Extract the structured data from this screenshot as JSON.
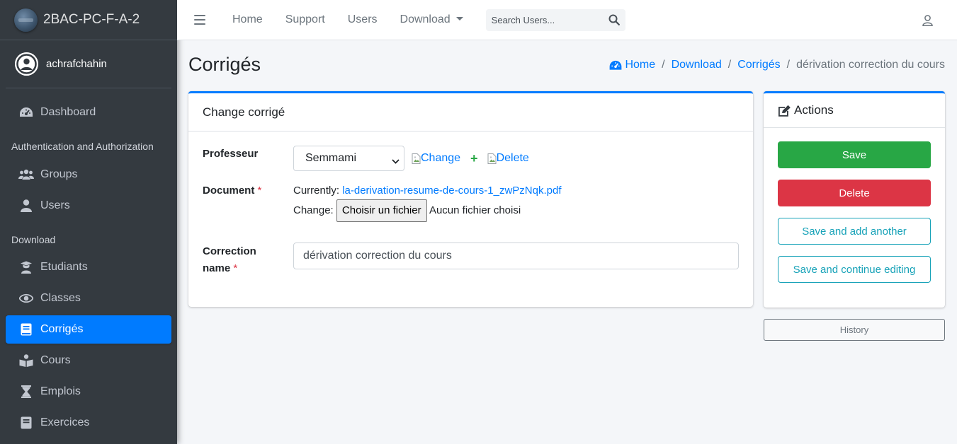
{
  "brand": {
    "name": "2BAC-PC-F-A-2"
  },
  "user": {
    "name": "achrafchahin"
  },
  "sidebar": {
    "dashboard": "Dashboard",
    "section_auth": "Authentication and Authorization",
    "groups": "Groups",
    "users": "Users",
    "section_download": "Download",
    "etudiants": "Etudiants",
    "classes": "Classes",
    "corriges": "Corrigés",
    "cours": "Cours",
    "emplois": "Emplois",
    "exercices": "Exercices",
    "active_color": "#007bff"
  },
  "topnav": {
    "home": "Home",
    "support": "Support",
    "users": "Users",
    "download": "Download",
    "search_placeholder": "Search Users..."
  },
  "page": {
    "title": "Corrigés"
  },
  "breadcrumb": {
    "home": "Home",
    "download": "Download",
    "corriges": "Corrigés",
    "current": "dérivation correction du cours"
  },
  "form": {
    "card_title": "Change corrigé",
    "professeur_label": "Professeur",
    "professeur_value": "Semmami",
    "change_link": "Change",
    "delete_link": "Delete",
    "document_label": "Document",
    "required_mark": "*",
    "currently_label": "Currently:",
    "current_file": "la-derivation-resume-de-cours-1_zwPzNqk.pdf",
    "change_label": "Change:",
    "choose_file_button": "Choisir un fichier",
    "no_file": "Aucun fichier choisi",
    "correction_label_line1": "Correction",
    "correction_label_line2": "name",
    "correction_value": "dérivation correction du cours"
  },
  "actions": {
    "title": "Actions",
    "save": "Save",
    "delete": "Delete",
    "save_add": "Save and add another",
    "save_continue": "Save and continue editing",
    "history": "History",
    "colors": {
      "save": "#28a745",
      "delete": "#dc3545",
      "outline": "#17a2b8",
      "accent": "#007bff"
    }
  }
}
